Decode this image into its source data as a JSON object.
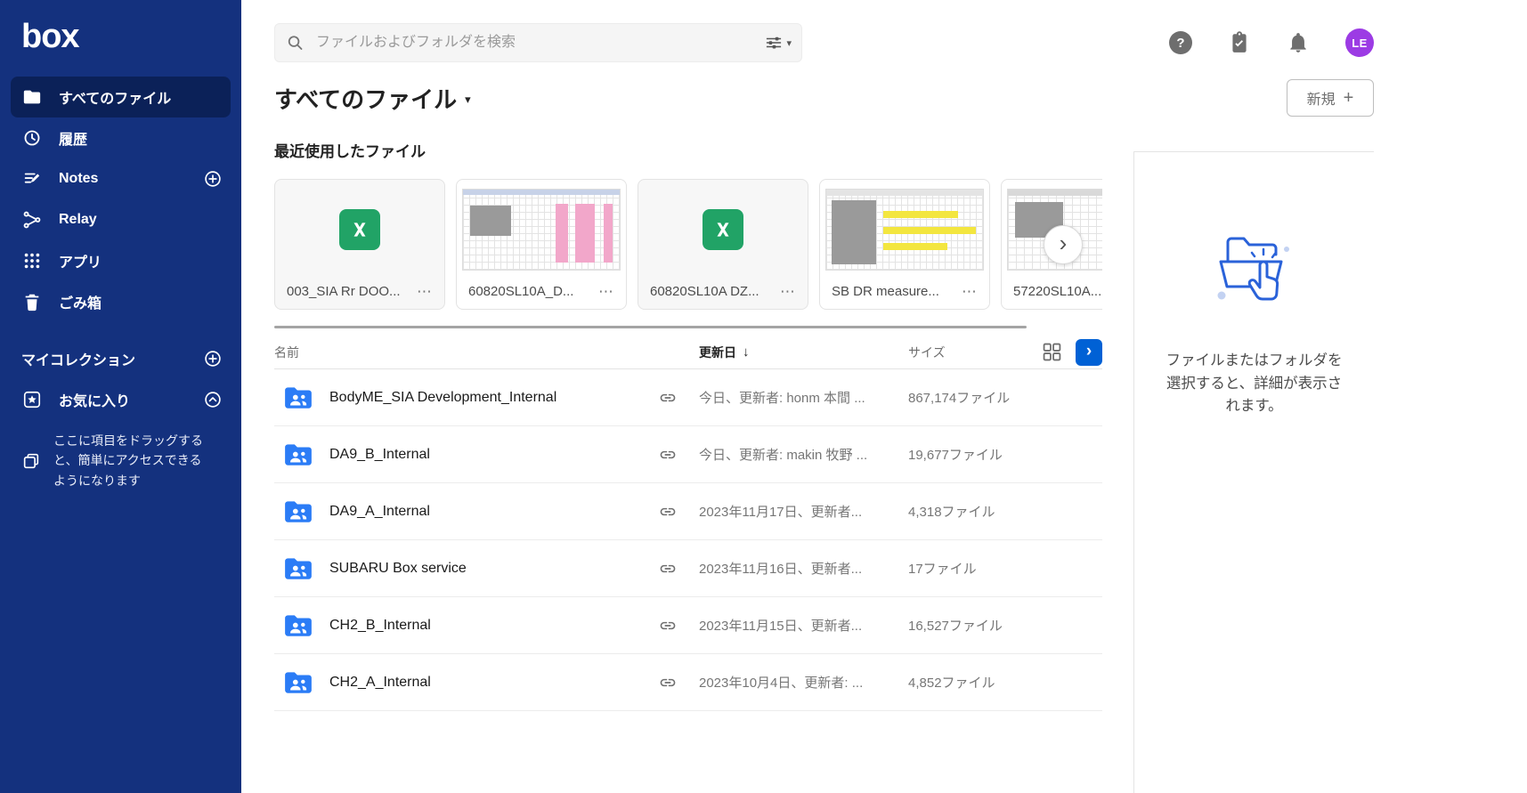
{
  "brand": {
    "logo_text": "box"
  },
  "sidebar": {
    "items": [
      {
        "label": "すべてのファイル",
        "active": true
      },
      {
        "label": "履歴"
      },
      {
        "label": "Notes"
      },
      {
        "label": "Relay"
      },
      {
        "label": "アプリ"
      },
      {
        "label": "ごみ箱"
      }
    ],
    "collections_header": "マイコレクション",
    "favorites_label": "お気に入り",
    "drag_hint": "ここに項目をドラッグすると、簡単にアクセスできるようになります"
  },
  "topbar": {
    "search_placeholder": "ファイルおよびフォルダを検索",
    "avatar_initials": "LE"
  },
  "page": {
    "title": "すべてのファイル",
    "new_button_label": "新規",
    "recent_section_title": "最近使用したファイル"
  },
  "recent_files": [
    {
      "name": "003_SIA Rr DOO...",
      "kind": "excel"
    },
    {
      "name": "60820SL10A_D...",
      "kind": "sheet-pink"
    },
    {
      "name": "60820SL10A DZ...",
      "kind": "excel"
    },
    {
      "name": "SB DR measure...",
      "kind": "sheet-yellow"
    },
    {
      "name": "57220SL10A...",
      "kind": "sheet-plain"
    }
  ],
  "table": {
    "headers": {
      "name": "名前",
      "updated": "更新日",
      "size": "サイズ"
    },
    "sort_desc": true,
    "rows": [
      {
        "name": "BodyME_SIA Development_Internal",
        "updated": "今日、更新者: honm 本間 ...",
        "size": "867,174ファイル"
      },
      {
        "name": "DA9_B_Internal",
        "updated": "今日、更新者: makin 牧野 ...",
        "size": "19,677ファイル"
      },
      {
        "name": "DA9_A_Internal",
        "updated": "2023年11月17日、更新者...",
        "size": "4,318ファイル"
      },
      {
        "name": "SUBARU Box service",
        "updated": "2023年11月16日、更新者...",
        "size": "17ファイル"
      },
      {
        "name": "CH2_B_Internal",
        "updated": "2023年11月15日、更新者...",
        "size": "16,527ファイル"
      },
      {
        "name": "CH2_A_Internal",
        "updated": "2023年10月4日、更新者: ...",
        "size": "4,852ファイル"
      }
    ]
  },
  "details_panel": {
    "empty_message": "ファイルまたはフォルダを選択すると、詳細が表示されます。"
  },
  "glyphs": {
    "help": "?",
    "more": "⋯",
    "caret_down": "▾",
    "sort_desc": "↓",
    "chevron_right": "›",
    "plus": "+"
  },
  "colors": {
    "sidebar_bg": "#14317E",
    "accent_blue": "#0061D5",
    "folder_blue": "#2B7CF6",
    "excel_green": "#21A366",
    "avatar_purple": "#9C3BE4"
  }
}
